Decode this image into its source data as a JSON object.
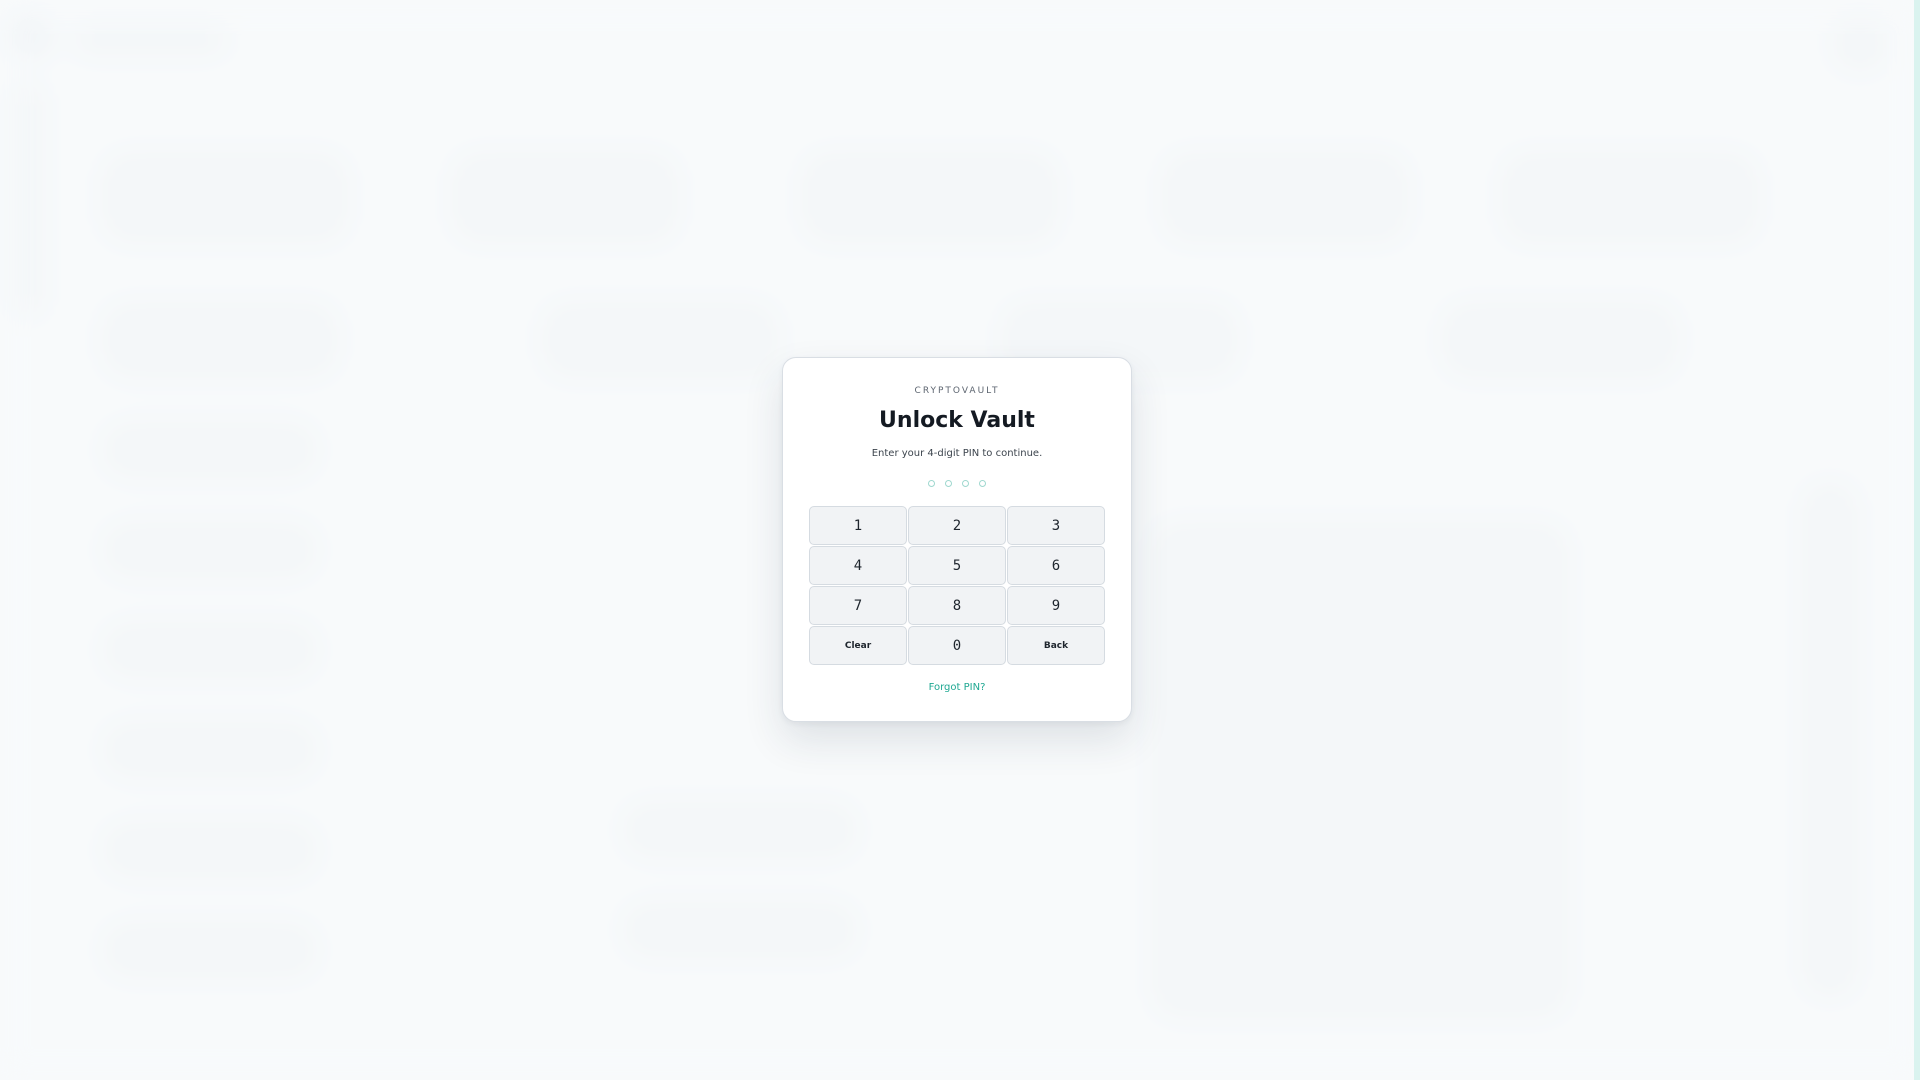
{
  "modal": {
    "brand": "CRYPTOVAULT",
    "title": "Unlock Vault",
    "subtitle": "Enter your 4-digit PIN to continue.",
    "pin_length": 4,
    "pin_entered": 0,
    "keys": {
      "k1": "1",
      "k2": "2",
      "k3": "3",
      "k4": "4",
      "k5": "5",
      "k6": "6",
      "k7": "7",
      "k8": "8",
      "k9": "9",
      "clear": "Clear",
      "k0": "0",
      "back": "Back"
    },
    "forgot_link": "Forgot PIN?"
  },
  "colors": {
    "accent": "#1fa892",
    "dot_border": "#9fd8cf",
    "key_background": "#f1f3f5",
    "background": "#f8fafc"
  }
}
